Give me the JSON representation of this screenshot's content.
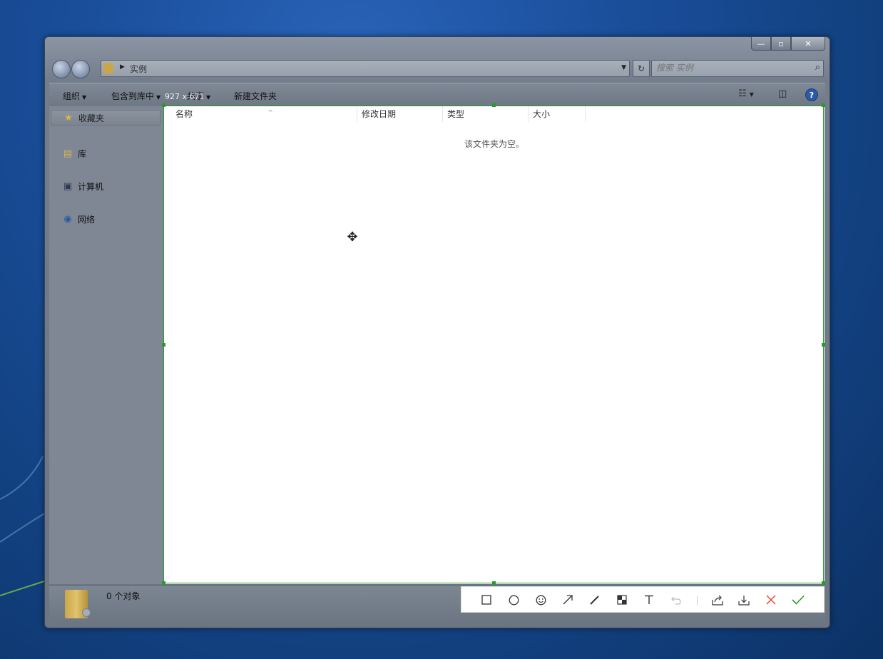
{
  "window": {
    "caption_buttons": {
      "minimize": "—",
      "maximize": "▫",
      "close": "✕"
    }
  },
  "navbar": {
    "path": "实例",
    "search_placeholder": "搜索 实例"
  },
  "toolbar": {
    "organize": "组织",
    "include_in_library": "包含到库中",
    "share": "共享",
    "new_folder": "新建文件夹"
  },
  "sidebar": {
    "favorites": "收藏夹",
    "library": "库",
    "computer": "计算机",
    "network": "网络"
  },
  "columns": [
    "名称",
    "修改日期",
    "类型",
    "大小"
  ],
  "empty_message": "该文件夹为空。",
  "status": {
    "count": "0 个对象"
  },
  "capture": {
    "dimensions": "927 x 671"
  },
  "icons": {
    "back": "back-arrow-icon",
    "forward": "forward-arrow-icon",
    "refresh": "refresh-icon",
    "search": "magnifier-icon",
    "views": "view-list-icon",
    "preview": "preview-pane-icon",
    "help": "help-icon"
  },
  "colors": {
    "selection": "#2b9a2b",
    "cancel": "#e04a3a",
    "confirm": "#2b9a2b"
  }
}
